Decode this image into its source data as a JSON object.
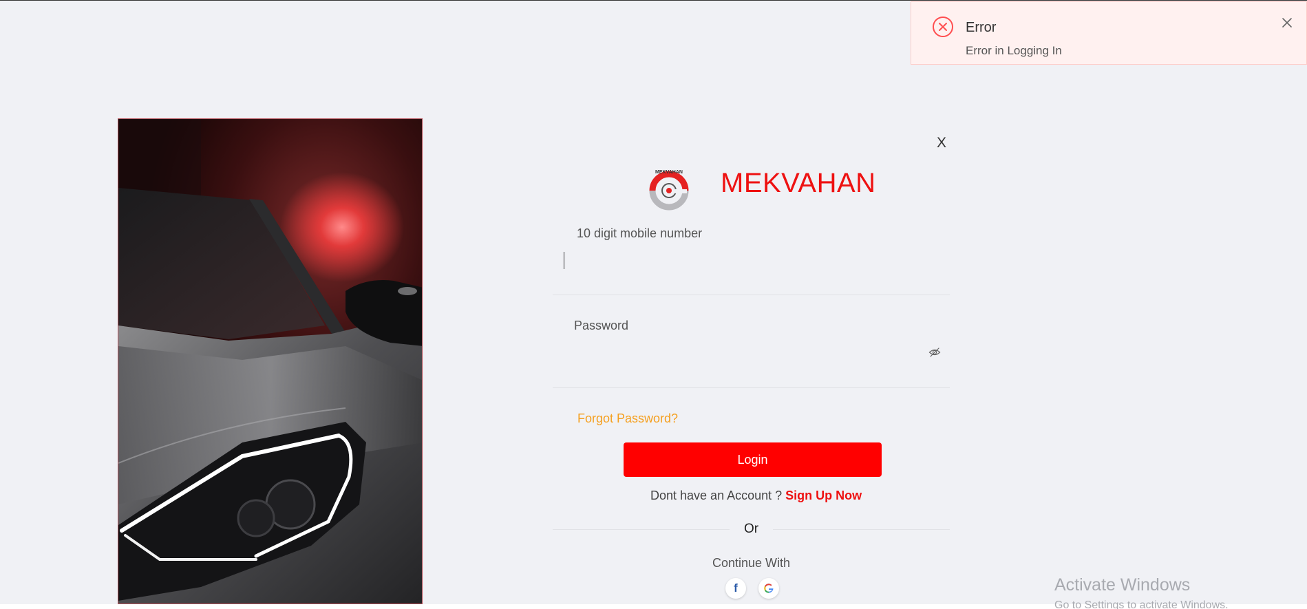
{
  "toast": {
    "icon": "error-circle-icon",
    "title": "Error",
    "message": "Error in Logging In",
    "close_icon": "close-icon",
    "accent": "#ff4d4f"
  },
  "card": {
    "close_label": "X",
    "brand_name": "MEKVAHAN",
    "brand_color": "#ee1111",
    "logo_text": "MEKVAHAN",
    "mobile": {
      "label": "10 digit mobile number",
      "value": "",
      "placeholder": ""
    },
    "password": {
      "label": "Password",
      "value": "",
      "placeholder": "",
      "toggle_icon": "eye-slash-icon"
    },
    "forgot_label": "Forgot Password?",
    "login_label": "Login",
    "signup_prompt": "Dont have an Account ? ",
    "signup_link": "Sign Up Now",
    "or_label": "Or",
    "continue_label": "Continue With",
    "social": [
      {
        "name": "facebook",
        "icon": "facebook-icon",
        "glyph": "f"
      },
      {
        "name": "google",
        "icon": "google-icon"
      }
    ],
    "accent": "#ff0000",
    "forgot_color": "#f5a020"
  },
  "side_image": {
    "subject": "car-headlight-image"
  },
  "watermark": {
    "title": "Activate Windows",
    "subtitle": "Go to Settings to activate Windows."
  }
}
